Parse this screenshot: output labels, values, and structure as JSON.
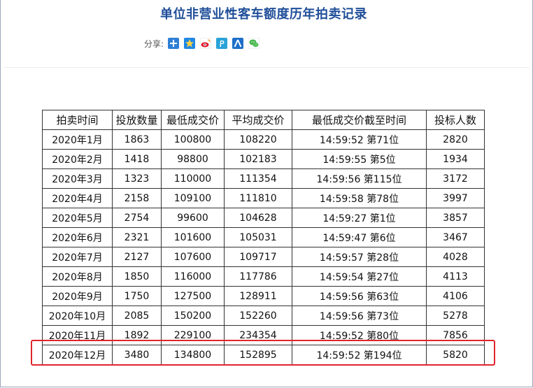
{
  "page": {
    "title": "单位非营业性客车额度历年拍卖记录",
    "share_label": "分享:",
    "share_icons": [
      "qzone-plus-icon",
      "qzone-star-icon",
      "weibo-icon",
      "pinterest-icon",
      "renren-icon",
      "wechat-icon"
    ]
  },
  "table": {
    "headers": [
      "拍卖时间",
      "投放数量",
      "最低成交价",
      "平均成交价",
      "最低成交价截至时间",
      "投标人数"
    ],
    "rows": [
      [
        "2020年1月",
        "1863",
        "100800",
        "108220",
        "14:59:52 第71位",
        "2820"
      ],
      [
        "2020年2月",
        "1418",
        "98800",
        "102183",
        "14:59:55 第5位",
        "1934"
      ],
      [
        "2020年3月",
        "1323",
        "110000",
        "111354",
        "14:59:56 第115位",
        "3172"
      ],
      [
        "2020年4月",
        "2158",
        "109100",
        "111810",
        "14:59:58 第78位",
        "3997"
      ],
      [
        "2020年5月",
        "2754",
        "99600",
        "104628",
        "14:59:27 第1位",
        "3857"
      ],
      [
        "2020年6月",
        "2321",
        "101600",
        "105031",
        "14:59:47 第6位",
        "3467"
      ],
      [
        "2020年7月",
        "2127",
        "107600",
        "109717",
        "14:59:57 第28位",
        "4028"
      ],
      [
        "2020年8月",
        "1850",
        "116000",
        "117786",
        "14:59:54 第27位",
        "4113"
      ],
      [
        "2020年9月",
        "1750",
        "127500",
        "128911",
        "14:59:56 第63位",
        "4106"
      ],
      [
        "2020年10月",
        "2085",
        "150200",
        "152260",
        "14:59:56 第73位",
        "5278"
      ],
      [
        "2020年11月",
        "1892",
        "229100",
        "234354",
        "14:59:52 第80位",
        "7856"
      ],
      [
        "2020年12月",
        "3480",
        "134800",
        "152895",
        "14:59:52 第194位",
        "5820"
      ]
    ]
  },
  "colors": {
    "title": "#1f4e99",
    "highlight": "#e0242b",
    "border": "#333333"
  }
}
